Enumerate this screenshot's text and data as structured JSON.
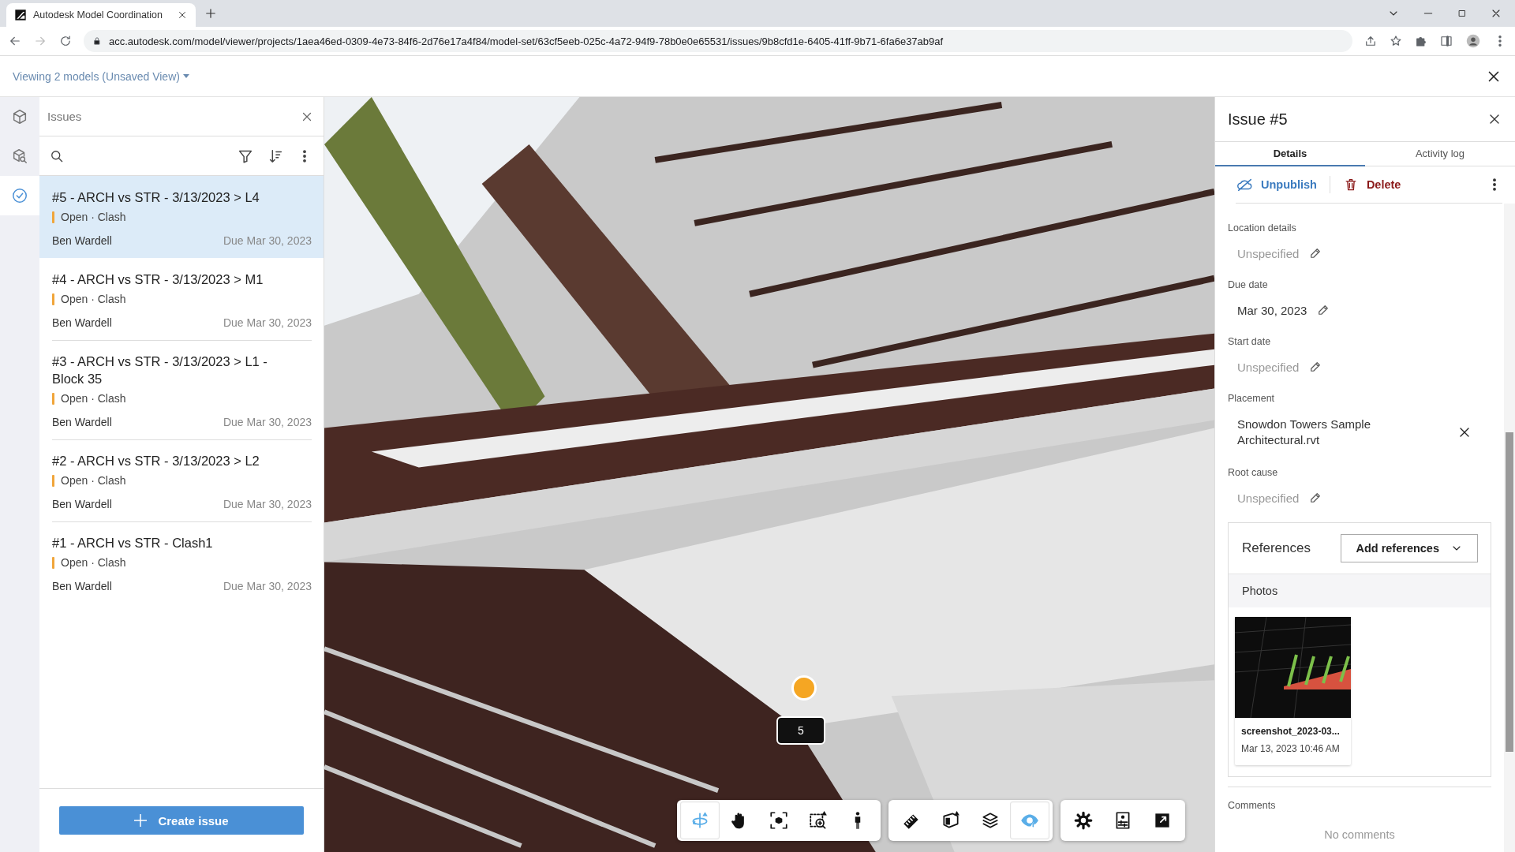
{
  "browser": {
    "tab_title": "Autodesk Model Coordination",
    "url": "acc.autodesk.com/model/viewer/projects/1aea46ed-0309-4e73-84f6-2d76e17a4f84/model-set/63cf5eeb-025c-4a72-94f9-78b0e0e65531/issues/9b8cfd1e-6405-41ff-9b71-6fa6e37ab9af"
  },
  "header": {
    "view_selector": "Viewing 2 models (Unsaved View)"
  },
  "rail": {
    "items": [
      {
        "kind": "models",
        "selected": false
      },
      {
        "kind": "search-models",
        "selected": false
      },
      {
        "kind": "issues",
        "selected": true
      }
    ]
  },
  "issues_panel": {
    "title": "Issues",
    "issues": [
      {
        "title": "#5 - ARCH vs STR - 3/13/2023 > L4",
        "meta": "Open · Clash",
        "assignee": "Ben Wardell",
        "due": "Due Mar 30, 2023",
        "selected": true
      },
      {
        "title": "#4 - ARCH vs STR - 3/13/2023 > M1",
        "meta": "Open · Clash",
        "assignee": "Ben Wardell",
        "due": "Due Mar 30, 2023",
        "selected": false
      },
      {
        "title": "#3 - ARCH vs STR - 3/13/2023 > L1 - Block 35",
        "meta": "Open · Clash",
        "assignee": "Ben Wardell",
        "due": "Due Mar 30, 2023",
        "selected": false
      },
      {
        "title": "#2 - ARCH vs STR - 3/13/2023 > L2",
        "meta": "Open · Clash",
        "assignee": "Ben Wardell",
        "due": "Due Mar 30, 2023",
        "selected": false
      },
      {
        "title": "#1 - ARCH vs STR - Clash1",
        "meta": "Open · Clash",
        "assignee": "Ben Wardell",
        "due": "Due Mar 30, 2023",
        "selected": false
      }
    ],
    "create_button": "Create issue"
  },
  "viewer": {
    "pin_label": "5",
    "toolbar": [
      {
        "tools": [
          {
            "kind": "orbit",
            "selected": true
          },
          {
            "kind": "pan",
            "selected": false
          },
          {
            "kind": "fit",
            "selected": false
          },
          {
            "kind": "zoom",
            "selected": false
          },
          {
            "kind": "walk",
            "selected": false
          }
        ]
      },
      {
        "tools": [
          {
            "kind": "measure",
            "selected": false
          },
          {
            "kind": "section",
            "selected": false
          },
          {
            "kind": "layers",
            "selected": false
          },
          {
            "kind": "visibility",
            "selected": true
          }
        ]
      },
      {
        "tools": [
          {
            "kind": "settings",
            "selected": false
          },
          {
            "kind": "properties",
            "selected": false
          },
          {
            "kind": "fullscreen",
            "selected": false
          }
        ]
      }
    ]
  },
  "detail": {
    "title": "Issue #5",
    "tabs": [
      {
        "label": "Details",
        "selected": true
      },
      {
        "label": "Activity log",
        "selected": false
      }
    ],
    "actions": {
      "unpublish": "Unpublish",
      "delete": "Delete"
    },
    "fields": [
      {
        "label": "Location details",
        "value": "Unspecified",
        "empty": true,
        "kind": "editable"
      },
      {
        "label": "Due date",
        "value": "Mar 30, 2023",
        "empty": false,
        "kind": "editable"
      },
      {
        "label": "Start date",
        "value": "Unspecified",
        "empty": true,
        "kind": "editable"
      },
      {
        "label": "Placement",
        "value": "Snowdon Towers Sample Architectural.rvt",
        "empty": false,
        "kind": "removable"
      },
      {
        "label": "Root cause",
        "value": "Unspecified",
        "empty": true,
        "kind": "editable"
      }
    ],
    "references": {
      "title": "References",
      "add_button": "Add references",
      "section": "Photos",
      "photos": [
        {
          "name": "screenshot_2023-03...",
          "date": "Mar 13, 2023 10:46 AM"
        }
      ]
    },
    "comments": {
      "label": "Comments",
      "empty_text": "No comments"
    }
  }
}
